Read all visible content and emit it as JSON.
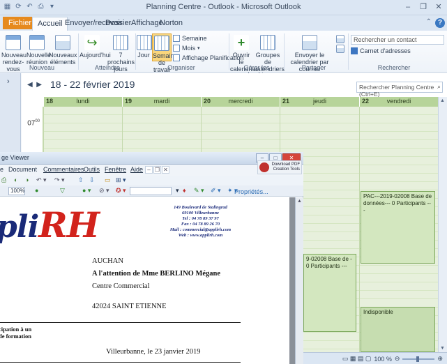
{
  "outlook": {
    "window_title": "Planning Centre - Outlook - Microsoft Outlook",
    "tabs": [
      "Fichier",
      "Accueil",
      "Envoyer/recevoir",
      "Dossier",
      "Affichage",
      "Norton"
    ],
    "ribbon": {
      "buttons": [
        {
          "label": "Nouveau rendez-vous"
        },
        {
          "label": "Nouvelle réunion"
        },
        {
          "label": "Nouveaux éléments"
        },
        {
          "label": "Aujourd'hui"
        },
        {
          "label": "7 prochains jours"
        },
        {
          "label": "Jour"
        },
        {
          "label": "Semaine de travail"
        },
        {
          "label": "Semaine"
        },
        {
          "label": "Mois"
        },
        {
          "label": "Affichage Planification"
        },
        {
          "label": "Ouvrir le calendrier"
        },
        {
          "label": "Groupes de calendriers"
        },
        {
          "label": "Envoyer le calendrier par courrier électronique"
        }
      ],
      "groups": [
        "Nouveau",
        "Atteindre",
        "Organiser",
        "Gérer les calendriers",
        "Partager",
        "Rechercher"
      ],
      "search_contact_placeholder": "Rechercher un contact",
      "address_book": "Carnet d'adresses"
    },
    "calendar": {
      "range": "18 - 22 février 2019",
      "search_placeholder": "Rechercher Planning Centre (Ctrl+E)",
      "days": [
        {
          "num": "18",
          "name": "lundi"
        },
        {
          "num": "19",
          "name": "mardi"
        },
        {
          "num": "20",
          "name": "mercredi"
        },
        {
          "num": "21",
          "name": "jeudi"
        },
        {
          "num": "22",
          "name": "vendredi"
        }
      ],
      "hour": "07",
      "hour_minutes": "00",
      "appointments": [
        {
          "text": "PAC---2019-02008 Base de données--- 0 Participants ---"
        },
        {
          "text": "9-02008 Base de - 0 Participants ---"
        },
        {
          "text": "Indisponible"
        }
      ],
      "zoom": "100 %"
    }
  },
  "adobe": {
    "window_title": "ge Viewer",
    "menu": [
      "Document",
      "Commentaires",
      "Outils",
      "Fenêtre",
      "Aide"
    ],
    "download_badge": "Download PDF Creation Tools",
    "zoom": "100%",
    "properties": "Propriétés..."
  },
  "letter": {
    "logo_part1": "pli",
    "logo_part2": "RH",
    "sender": {
      "line1": "149 Boulevard de Stalingrad",
      "line2": "69100 Villeurbanne",
      "line3": "Tel : 04 78 89 37 97",
      "line4": "Fax : 04 78 89 26 70",
      "line5": "Mail : commercial@applirh.com",
      "line6": "Web : www.applirh.com"
    },
    "recipient": {
      "company": "AUCHAN",
      "attention": "A l'attention de Mme BERLINO Mégane",
      "site": "Centre Commercial",
      "city": "42024 SAINT ETIENNE"
    },
    "subject_line1": "cipation à un",
    "subject_line2": "de formation",
    "date": "Villeurbanne, le 23 janvier 2019"
  }
}
